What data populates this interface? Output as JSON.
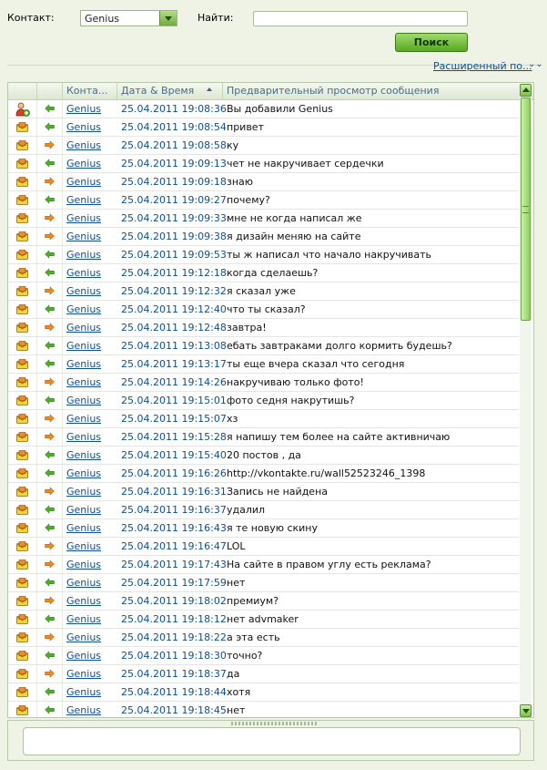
{
  "filter": {
    "contact_label": "Контакт:",
    "contact_value": "Genius",
    "search_label": "Найти:",
    "search_value": "",
    "search_button": "Поиск",
    "advanced_link": "Расширенный по...",
    "advanced_chevron": "chevron-down-double"
  },
  "colors": {
    "accent_green": "#6fae3a",
    "link_blue": "#0d4f8f",
    "incoming_arrow": "#4caf28",
    "outgoing_arrow": "#f08a1c"
  },
  "table": {
    "columns": [
      "Конта...",
      "Дата & Время",
      "Предварительный просмотр сообщения"
    ],
    "rows": [
      {
        "icon": "contact-added-icon",
        "dir": "in",
        "contact": "Genius",
        "datetime": "25.04.2011 19:08:36",
        "message": "Вы добавили Genius"
      },
      {
        "icon": "message-icon",
        "dir": "in",
        "contact": "Genius",
        "datetime": "25.04.2011 19:08:54",
        "message": "привет"
      },
      {
        "icon": "message-icon",
        "dir": "out",
        "contact": "Genius",
        "datetime": "25.04.2011 19:08:58",
        "message": "ку"
      },
      {
        "icon": "message-icon",
        "dir": "in",
        "contact": "Genius",
        "datetime": "25.04.2011 19:09:13",
        "message": "чет не накручивает сердечки"
      },
      {
        "icon": "message-icon",
        "dir": "out",
        "contact": "Genius",
        "datetime": "25.04.2011 19:09:18",
        "message": "знаю"
      },
      {
        "icon": "message-icon",
        "dir": "in",
        "contact": "Genius",
        "datetime": "25.04.2011 19:09:27",
        "message": "почему?"
      },
      {
        "icon": "message-icon",
        "dir": "out",
        "contact": "Genius",
        "datetime": "25.04.2011 19:09:33",
        "message": "мне не когда написал же"
      },
      {
        "icon": "message-icon",
        "dir": "out",
        "contact": "Genius",
        "datetime": "25.04.2011 19:09:38",
        "message": "я дизайн меняю на сайте"
      },
      {
        "icon": "message-icon",
        "dir": "in",
        "contact": "Genius",
        "datetime": "25.04.2011 19:09:53",
        "message": "ты ж написал что начало накручивать"
      },
      {
        "icon": "message-icon",
        "dir": "in",
        "contact": "Genius",
        "datetime": "25.04.2011 19:12:18",
        "message": "когда сделаешь?"
      },
      {
        "icon": "message-icon",
        "dir": "out",
        "contact": "Genius",
        "datetime": "25.04.2011 19:12:32",
        "message": "я сказал уже"
      },
      {
        "icon": "message-icon",
        "dir": "in",
        "contact": "Genius",
        "datetime": "25.04.2011 19:12:40",
        "message": "что ты сказал?"
      },
      {
        "icon": "message-icon",
        "dir": "out",
        "contact": "Genius",
        "datetime": "25.04.2011 19:12:48",
        "message": "завтра!"
      },
      {
        "icon": "message-icon",
        "dir": "in",
        "contact": "Genius",
        "datetime": "25.04.2011 19:13:08",
        "message": "ебать завтраками долго кормить будешь?"
      },
      {
        "icon": "message-icon",
        "dir": "in",
        "contact": "Genius",
        "datetime": "25.04.2011 19:13:17",
        "message": "ты еще вчера сказал что сегодня"
      },
      {
        "icon": "message-icon",
        "dir": "out",
        "contact": "Genius",
        "datetime": "25.04.2011 19:14:26",
        "message": "накручиваю только фото!"
      },
      {
        "icon": "message-icon",
        "dir": "in",
        "contact": "Genius",
        "datetime": "25.04.2011 19:15:01",
        "message": "фото седня накрутишь?"
      },
      {
        "icon": "message-icon",
        "dir": "out",
        "contact": "Genius",
        "datetime": "25.04.2011 19:15:07",
        "message": "хз"
      },
      {
        "icon": "message-icon",
        "dir": "out",
        "contact": "Genius",
        "datetime": "25.04.2011 19:15:28",
        "message": "я напишу тем более на сайте активничаю"
      },
      {
        "icon": "message-icon",
        "dir": "in",
        "contact": "Genius",
        "datetime": "25.04.2011 19:15:40",
        "message": "20 постов , да"
      },
      {
        "icon": "message-icon",
        "dir": "in",
        "contact": "Genius",
        "datetime": "25.04.2011 19:16:26",
        "message": "http://vkontakte.ru/wall52523246_1398"
      },
      {
        "icon": "message-icon",
        "dir": "out",
        "contact": "Genius",
        "datetime": "25.04.2011 19:16:31",
        "message": "Запись не найдена"
      },
      {
        "icon": "message-icon",
        "dir": "in",
        "contact": "Genius",
        "datetime": "25.04.2011 19:16:37",
        "message": "удалил"
      },
      {
        "icon": "message-icon",
        "dir": "in",
        "contact": "Genius",
        "datetime": "25.04.2011 19:16:43",
        "message": "я те новую скину"
      },
      {
        "icon": "message-icon",
        "dir": "out",
        "contact": "Genius",
        "datetime": "25.04.2011 19:16:47",
        "message": "LOL"
      },
      {
        "icon": "message-icon",
        "dir": "out",
        "contact": "Genius",
        "datetime": "25.04.2011 19:17:43",
        "message": "На сайте в правом углу есть реклама?"
      },
      {
        "icon": "message-icon",
        "dir": "in",
        "contact": "Genius",
        "datetime": "25.04.2011 19:17:59",
        "message": "нет"
      },
      {
        "icon": "message-icon",
        "dir": "out",
        "contact": "Genius",
        "datetime": "25.04.2011 19:18:02",
        "message": "премиум?"
      },
      {
        "icon": "message-icon",
        "dir": "in",
        "contact": "Genius",
        "datetime": "25.04.2011 19:18:12",
        "message": "нет advmaker"
      },
      {
        "icon": "message-icon",
        "dir": "out",
        "contact": "Genius",
        "datetime": "25.04.2011 19:18:22",
        "message": "а эта есть"
      },
      {
        "icon": "message-icon",
        "dir": "in",
        "contact": "Genius",
        "datetime": "25.04.2011 19:18:30",
        "message": "точно?"
      },
      {
        "icon": "message-icon",
        "dir": "out",
        "contact": "Genius",
        "datetime": "25.04.2011 19:18:37",
        "message": "да"
      },
      {
        "icon": "message-icon",
        "dir": "in",
        "contact": "Genius",
        "datetime": "25.04.2011 19:18:44",
        "message": "хотя"
      },
      {
        "icon": "message-icon",
        "dir": "in",
        "contact": "Genius",
        "datetime": "25.04.2011 19:18:45",
        "message": "нет"
      }
    ]
  },
  "composer": {
    "value": ""
  }
}
